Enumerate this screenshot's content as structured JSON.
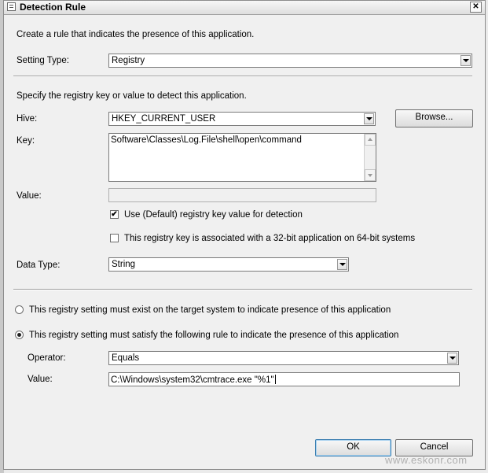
{
  "window": {
    "title": "Detection Rule",
    "close_glyph": "✕"
  },
  "intro_text": "Create a rule that indicates the presence of this application.",
  "setting_type": {
    "label": "Setting Type:",
    "value": "Registry"
  },
  "specify_text": "Specify the registry key or value to detect this application.",
  "hive": {
    "label": "Hive:",
    "value": "HKEY_CURRENT_USER"
  },
  "browse_label": "Browse...",
  "key": {
    "label": "Key:",
    "value": "Software\\Classes\\Log.File\\shell\\open\\command"
  },
  "value_field": {
    "label": "Value:",
    "value": ""
  },
  "check_default": {
    "label": "Use (Default) registry key value for detection",
    "checked": true,
    "glyph": "✔"
  },
  "check_32bit": {
    "label": "This registry key is associated with a 32-bit application on 64-bit systems",
    "checked": false
  },
  "data_type": {
    "label": "Data Type:",
    "value": "String"
  },
  "radio_exist": {
    "label": "This registry setting must exist on the target system to indicate presence of this application",
    "selected": false
  },
  "radio_satisfy": {
    "label": "This registry setting must satisfy the following rule to indicate the presence of this application",
    "selected": true
  },
  "operator": {
    "label": "Operator:",
    "value": "Equals"
  },
  "rule_value": {
    "label": "Value:",
    "value": "C:\\Windows\\system32\\cmtrace.exe \"%1\""
  },
  "buttons": {
    "ok": "OK",
    "cancel": "Cancel"
  },
  "watermark": "www.eskonr.com",
  "colors": {
    "window_bg": "#f0f0f0",
    "default_button_border": "#3c7fb1"
  }
}
